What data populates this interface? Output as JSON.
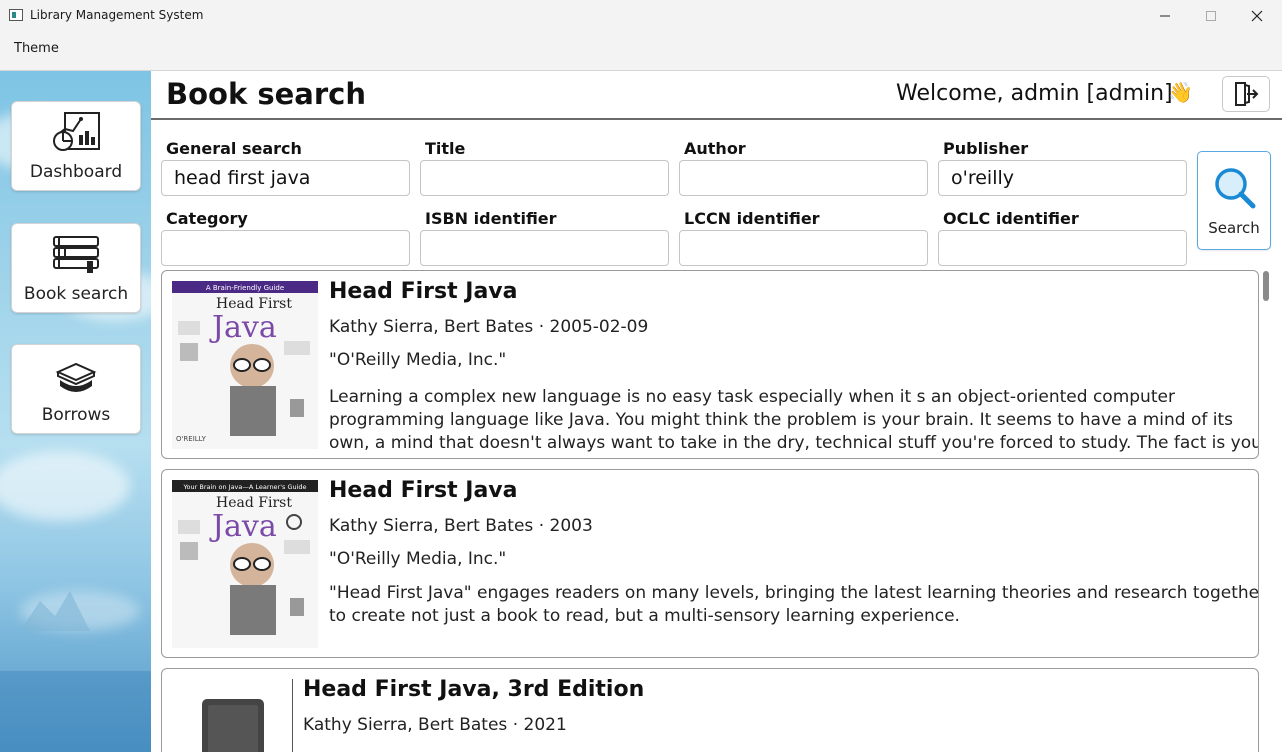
{
  "window": {
    "title": "Library Management System"
  },
  "menu": {
    "theme": "Theme"
  },
  "sidebar": {
    "items": [
      {
        "label": "Dashboard",
        "icon": "dashboard-chart-icon"
      },
      {
        "label": "Book search",
        "icon": "book-stack-icon"
      },
      {
        "label": "Borrows",
        "icon": "hand-book-icon"
      }
    ]
  },
  "header": {
    "title": "Book search",
    "welcome": "Welcome, admin [admin]",
    "wave": "👋"
  },
  "search": {
    "general_label": "General search",
    "general_value": "head first java",
    "title_label": "Title",
    "title_value": "",
    "author_label": "Author",
    "author_value": "",
    "publisher_label": "Publisher",
    "publisher_value": "o'reilly",
    "category_label": "Category",
    "category_value": "",
    "isbn_label": "ISBN identifier",
    "isbn_value": "",
    "lccn_label": "LCCN identifier",
    "lccn_value": "",
    "oclc_label": "OCLC identifier",
    "oclc_value": "",
    "button_label": "Search"
  },
  "results": [
    {
      "title": "Head First Java",
      "authors_date": "Kathy Sierra, Bert Bates · 2005-02-09",
      "publisher": "\"O'Reilly Media, Inc.\"",
      "description": "Learning a complex new language is no easy task especially when it s an object-oriented computer programming language like Java. You might think the problem is your brain. It seems to have a mind of its own, a mind that doesn't always want to take in the dry, technical stuff you're forced to study. The fact is your brain craves novelty. It's ...",
      "cover_top_text": "A Brain-Friendly Guide",
      "cover_title": "Head First",
      "cover_big": "Java"
    },
    {
      "title": "Head First Java",
      "authors_date": "Kathy Sierra, Bert Bates · 2003",
      "publisher": "\"O'Reilly Media, Inc.\"",
      "description": "\"Head First Java\" engages readers on many levels, bringing the latest learning theories and research together to create not just a book to read, but a multi-sensory learning experience.",
      "cover_top_text": "Your Brain on Java—A Learner's Guide",
      "cover_title": "Head First",
      "cover_big": "Java"
    },
    {
      "title": "Head First Java, 3rd Edition",
      "authors_date": "Kathy Sierra, Bert Bates · 2021"
    }
  ],
  "colors": {
    "accent": "#1a8ad4",
    "cover_purple": "#4b2a86",
    "sidebar_sky": "#9fd3ea"
  }
}
